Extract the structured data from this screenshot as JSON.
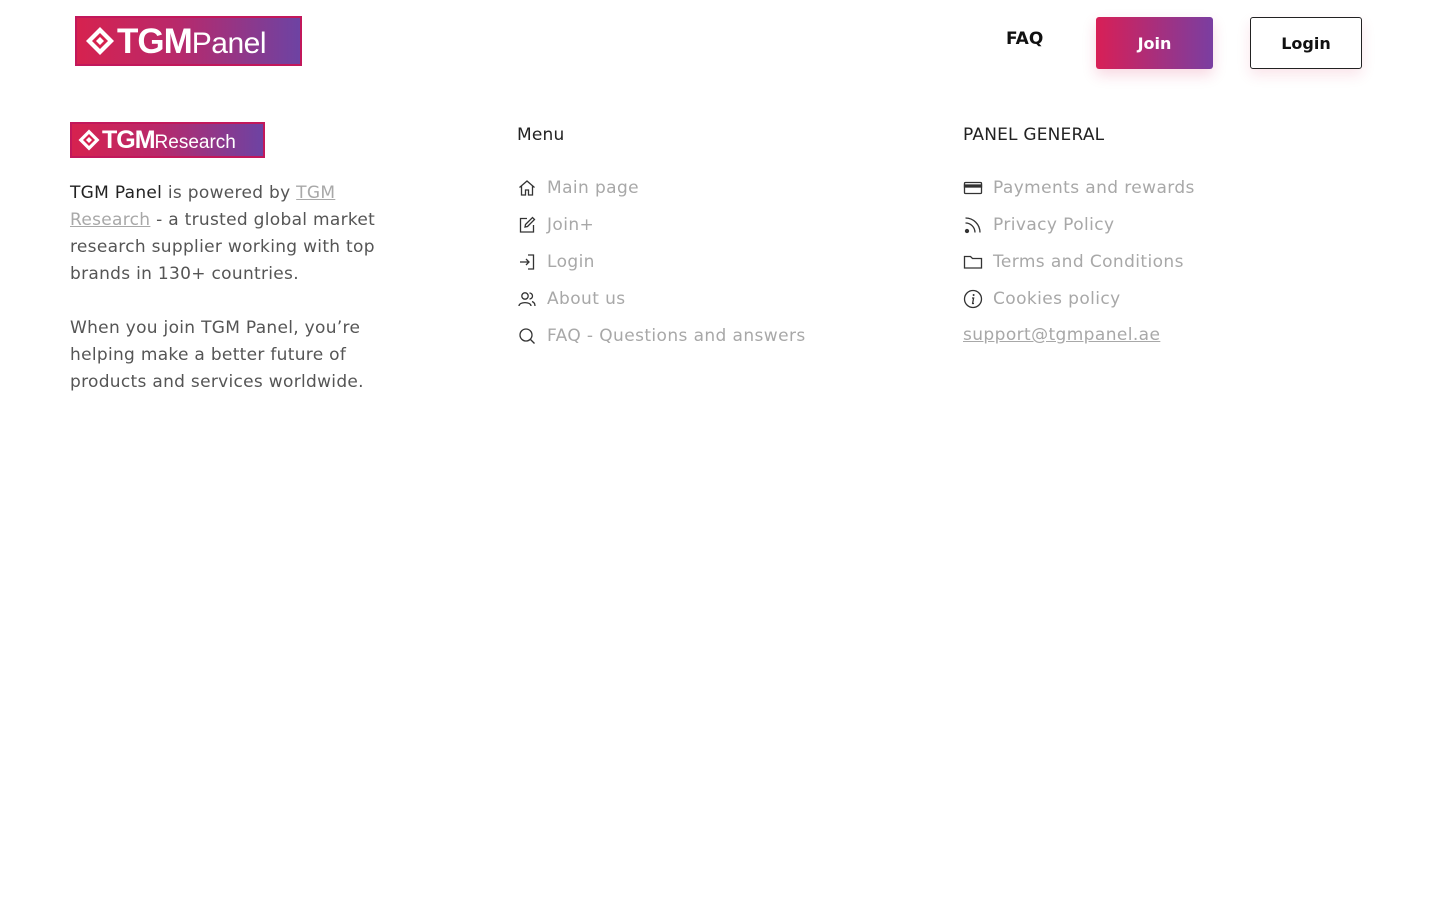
{
  "header": {
    "logo": {
      "bold": "TGM",
      "light": "Panel"
    },
    "nav_faq": "FAQ",
    "join_label": "Join",
    "login_label": "Login"
  },
  "about": {
    "logo": {
      "bold": "TGM",
      "light": "Research"
    },
    "brand": "TGM Panel",
    "powered_by": " is powered by ",
    "research_link": "TGM Research",
    "description": " - a trusted global market research supplier working with top brands in 130+ countries.",
    "paragraph2": "When you join TGM Panel, you’re helping make a better future of products and services worldwide."
  },
  "menu": {
    "title": "Menu",
    "items": [
      {
        "label": "Main page",
        "icon": "home-icon"
      },
      {
        "label": "Join+",
        "icon": "edit-icon"
      },
      {
        "label": "Login",
        "icon": "login-icon"
      },
      {
        "label": "About us",
        "icon": "users-icon"
      },
      {
        "label": "FAQ - Questions and answers",
        "icon": "search-icon"
      }
    ]
  },
  "general": {
    "title": "PANEL GENERAL",
    "items": [
      {
        "label": "Payments and rewards",
        "icon": "credit-card-icon"
      },
      {
        "label": "Privacy Policy",
        "icon": "rss-icon"
      },
      {
        "label": "Terms and Conditions",
        "icon": "folder-icon"
      },
      {
        "label": "Cookies policy",
        "icon": "info-icon"
      }
    ],
    "email": "support@tgmpanel.ae"
  }
}
